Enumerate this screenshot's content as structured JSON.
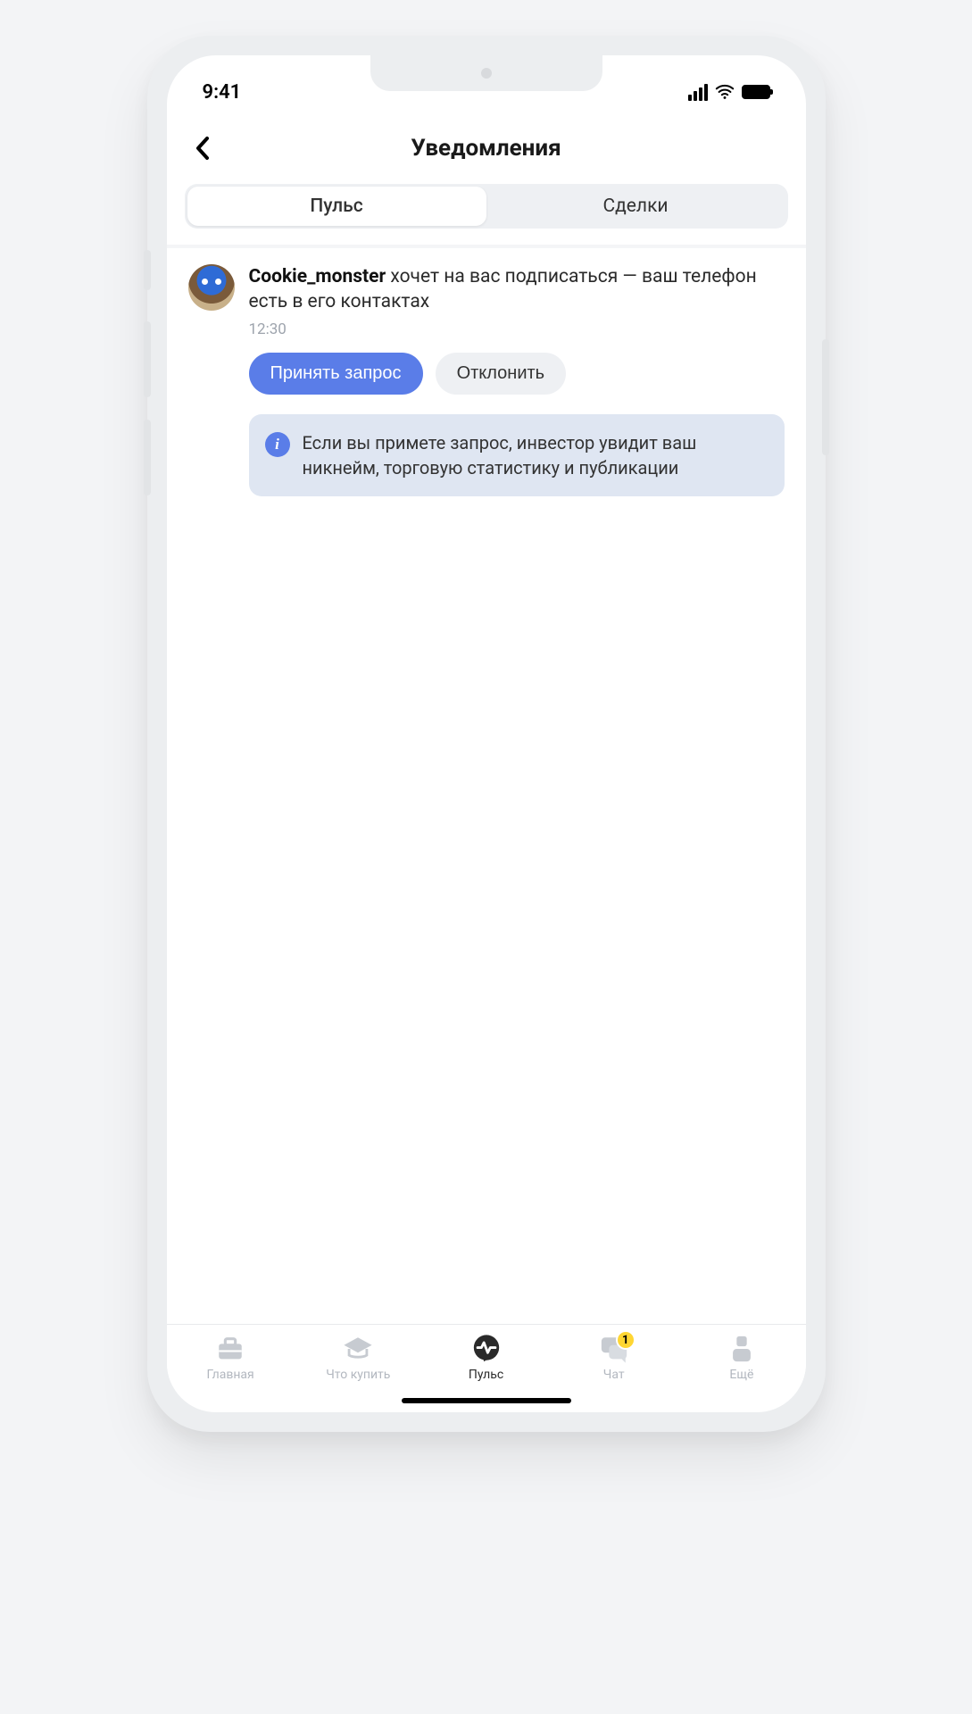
{
  "status": {
    "time": "9:41"
  },
  "header": {
    "title": "Уведомления"
  },
  "segmented": {
    "tabs": [
      {
        "label": "Пульс",
        "active": true
      },
      {
        "label": "Сделки",
        "active": false
      }
    ]
  },
  "notification": {
    "username": "Cookie_monster",
    "message_suffix": " хочет на вас подписаться — ваш телефон есть в его контактах",
    "time": "12:30",
    "accept_label": "Принять запрос",
    "decline_label": "Отклонить",
    "info_text": "Если вы примете запрос, инвестор увидит ваш никнейм, торговую статистику и публикации"
  },
  "tabbar": {
    "items": [
      {
        "label": "Главная",
        "icon": "briefcase",
        "active": false,
        "badge": null
      },
      {
        "label": "Что купить",
        "icon": "grad-cap",
        "active": false,
        "badge": null
      },
      {
        "label": "Пульс",
        "icon": "pulse-bubble",
        "active": true,
        "badge": null
      },
      {
        "label": "Чат",
        "icon": "chat",
        "active": false,
        "badge": "1"
      },
      {
        "label": "Ещё",
        "icon": "person",
        "active": false,
        "badge": null
      }
    ]
  }
}
